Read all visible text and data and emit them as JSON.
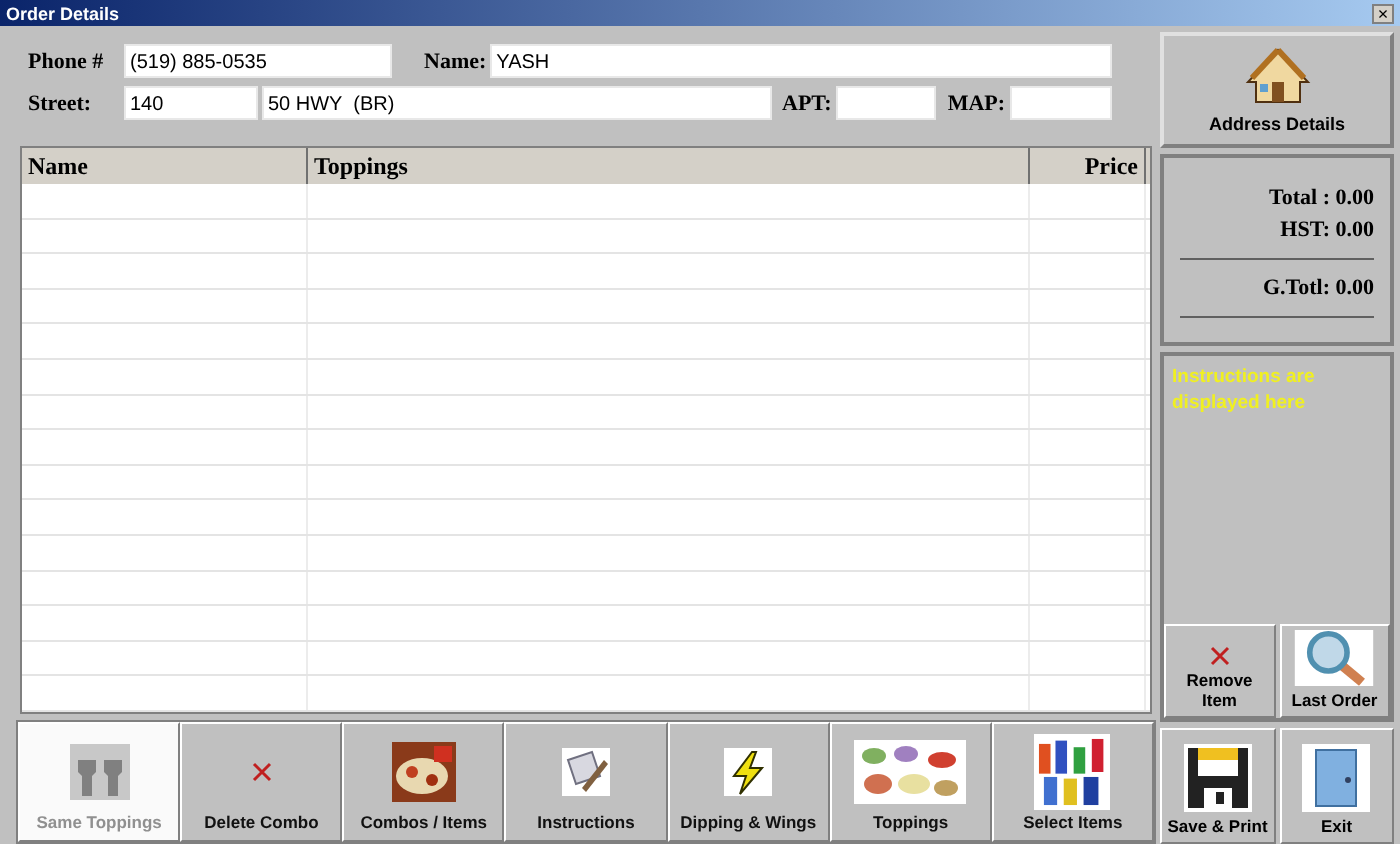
{
  "window": {
    "title": "Order Details",
    "close": "×"
  },
  "customer": {
    "phone": {
      "label": "Phone #",
      "value": "(519) 885-0535"
    },
    "name": {
      "label": "Name:",
      "value": "YASH"
    },
    "street": {
      "label": "Street:",
      "number": "140",
      "name": "50 HWY  (BR)"
    },
    "apt": {
      "label": "APT:"
    },
    "map": {
      "label": "MAP:"
    }
  },
  "table": {
    "columns": [
      "Name",
      "Toppings",
      "Price"
    ]
  },
  "address_button": {
    "label": "Address Details"
  },
  "totals": [
    {
      "label": "Total :",
      "value": "0.00",
      "kind": "line"
    },
    {
      "label": "HST:",
      "value": "0.00",
      "kind": "line"
    },
    {
      "label": "G.Totl:",
      "value": "0.00",
      "kind": "grand"
    }
  ],
  "instructions": "Instructions are displayed here",
  "item_actions": [
    {
      "label": "Remove Item",
      "kind": "remove"
    },
    {
      "label": "Last Order",
      "kind": "last-order"
    }
  ],
  "toolbar": [
    {
      "label": "Same Toppings",
      "kind": "same",
      "disabled": true
    },
    {
      "label": "Delete Combo",
      "kind": "remove",
      "disabled": false
    },
    {
      "label": "Combos / Items",
      "kind": "combos",
      "disabled": false
    },
    {
      "label": "Instructions",
      "kind": "instructions",
      "disabled": false
    },
    {
      "label": "Dipping & Wings",
      "kind": "lightning",
      "disabled": false
    },
    {
      "label": "Toppings",
      "kind": "toppings",
      "disabled": false
    },
    {
      "label": "Select Items",
      "kind": "bottles",
      "disabled": false
    }
  ],
  "final_actions": [
    {
      "label": "Save & Print",
      "kind": "save"
    },
    {
      "label": "Exit",
      "kind": "exit"
    }
  ]
}
